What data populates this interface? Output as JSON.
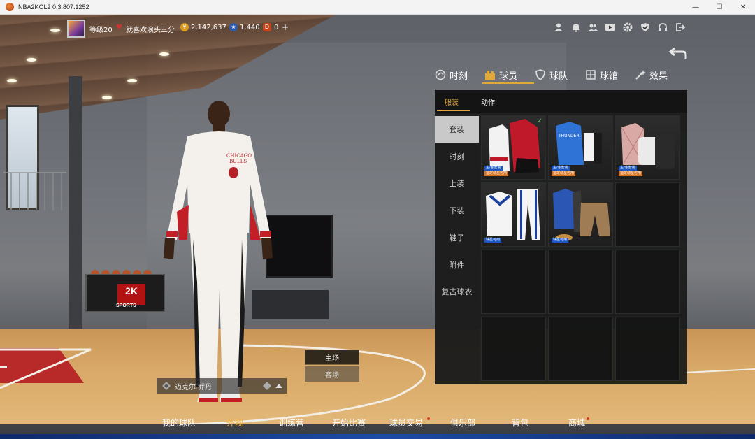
{
  "window": {
    "title": "NBA2KOL2 0.3.807.1252"
  },
  "status": {
    "level": "等级20",
    "nickname": "就喜欢浪头三分",
    "coins": "2,142,637",
    "stars": "1,440",
    "tickets": "0",
    "plus": "+"
  },
  "category_tabs": [
    {
      "label": "时刻",
      "icon": "moment-icon"
    },
    {
      "label": "球员",
      "icon": "player-icon",
      "active": true
    },
    {
      "label": "球队",
      "icon": "team-shield-icon"
    },
    {
      "label": "球馆",
      "icon": "arena-icon"
    },
    {
      "label": "效果",
      "icon": "effect-wand-icon"
    }
  ],
  "sub_tabs": [
    "服装",
    "动作"
  ],
  "sidebar": [
    "套装",
    "时刻",
    "上装",
    "下装",
    "鞋子",
    "附件",
    "复古球衣"
  ],
  "items": [
    {
      "badges": [
        "主/客套装",
        "指定球星可用"
      ],
      "checked": true,
      "kind": "red-jacket"
    },
    {
      "badges": [
        "主/客套装",
        "指定球星可用"
      ],
      "checked": false,
      "kind": "blue-shirt"
    },
    {
      "badges": [
        "主/客套装",
        "指定球星可用"
      ],
      "checked": false,
      "kind": "plaid-bag"
    },
    {
      "badges": [
        "球星可用"
      ],
      "checked": false,
      "kind": "sailor"
    },
    {
      "badges": [
        "球星可用"
      ],
      "checked": false,
      "kind": "casual"
    }
  ],
  "home_away": {
    "home": "主场",
    "away": "客场"
  },
  "player_name": "迈克尔.乔丹",
  "bottom_nav": [
    {
      "label": "我的球队"
    },
    {
      "label": "外观",
      "active": true
    },
    {
      "label": "训练营"
    },
    {
      "label": "开始比赛"
    },
    {
      "label": "球员交易",
      "dot": true
    },
    {
      "label": "俱乐部"
    },
    {
      "label": "背包"
    },
    {
      "label": "商城",
      "dot": true
    }
  ],
  "colors": {
    "accent": "#f0b640",
    "panel": "#181818",
    "badge_blue": "#1d57c7",
    "badge_orange": "#d3731f"
  },
  "top_icons": [
    "profile-icon",
    "bell-icon",
    "friends-icon",
    "video-icon",
    "settings-icon",
    "shield-check-icon",
    "headset-icon",
    "exit-icon"
  ]
}
